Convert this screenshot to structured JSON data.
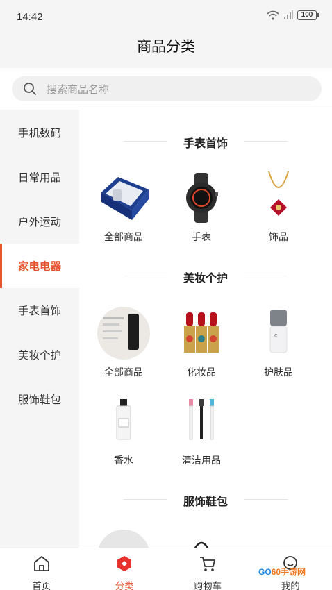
{
  "status_bar": {
    "time": "14:42",
    "battery": "100"
  },
  "header": {
    "title": "商品分类"
  },
  "search": {
    "placeholder": "搜索商品名称"
  },
  "sidebar": {
    "items": [
      {
        "label": "手机数码"
      },
      {
        "label": "日常用品"
      },
      {
        "label": "户外运动"
      },
      {
        "label": "家电电器"
      },
      {
        "label": "手表首饰"
      },
      {
        "label": "美妆个护"
      },
      {
        "label": "服饰鞋包"
      }
    ],
    "active_index": 3
  },
  "sections": [
    {
      "title": "手表首饰",
      "items": [
        {
          "label": "全部商品",
          "icon": "watch-box-image"
        },
        {
          "label": "手表",
          "icon": "smartwatch-image"
        },
        {
          "label": "饰品",
          "icon": "necklace-image"
        }
      ]
    },
    {
      "title": "美妆个护",
      "items": [
        {
          "label": "全部商品",
          "icon": "skincare-tube-image"
        },
        {
          "label": "化妆品",
          "icon": "lipsticks-image"
        },
        {
          "label": "护肤品",
          "icon": "cream-bottle-image"
        },
        {
          "label": "香水",
          "icon": "perfume-bottle-image"
        },
        {
          "label": "清洁用品",
          "icon": "toothbrush-heads-image"
        }
      ]
    },
    {
      "title": "服饰鞋包",
      "items": []
    }
  ],
  "bottom_nav": [
    {
      "label": "首页",
      "icon": "home-icon"
    },
    {
      "label": "分类",
      "icon": "category-icon",
      "active": true
    },
    {
      "label": "购物车",
      "icon": "cart-icon"
    },
    {
      "label": "我的",
      "icon": "profile-icon"
    }
  ],
  "watermark": {
    "text_a": "GO",
    "text_b": "60",
    "text_c": "手游网"
  },
  "colors": {
    "accent": "#e8522e",
    "background": "#f5f5f5",
    "panel": "#ffffff"
  }
}
